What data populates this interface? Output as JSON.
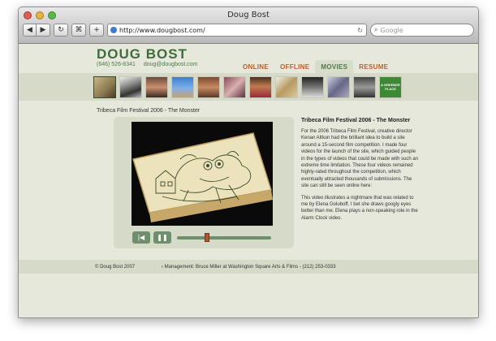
{
  "browser": {
    "title": "Doug Bost",
    "url": "http://www.dougbost.com/",
    "search_placeholder": "Google"
  },
  "site": {
    "logo": "DOUG BOST",
    "phone": "(646) 526-8341",
    "email": "doug@dougbost.com",
    "nav": [
      {
        "label": "ONLINE"
      },
      {
        "label": "OFFLINE"
      },
      {
        "label": "MOVIES"
      },
      {
        "label": "RESUME"
      }
    ],
    "active_nav": "MOVIES"
  },
  "thumbnails": {
    "last_label": "A GREENER PLACE"
  },
  "page_caption": "Tribeca Film Festival 2006 - The Monster",
  "player": {
    "progress": 0.32
  },
  "article": {
    "heading": "Tribeca Film Festival 2006 - The Monster",
    "p1": "For the 2006 Tribeca Film Festival, creative director Kenan Altkun had the brilliant idea to build a site around a 15-second film competition. I made four videos for the launch of the site, which guided people in the types of videos that could be made with such an extreme time limitation. These four videos remained highly-rated throughout the competition, which eventually attracted thousands of submissions. The site can still be seen online here:",
    "p2": "This video illustrates a nightmare that was related to me by Elena Goluboff. I bet she draws googly eyes better than me. Elena plays a non-speaking role in the Alarm Clock video."
  },
  "footer": {
    "copyright": "© Doug Bost 2007",
    "management": "› Management: Bruce Miller at Washington Square Arts & Films  -  (212) 253-0333"
  },
  "colors": {
    "accent_green": "#4c7b49",
    "nav_orange": "#b3632f",
    "page_bg": "#e6e8dc",
    "band_bg": "#d6dac8"
  }
}
